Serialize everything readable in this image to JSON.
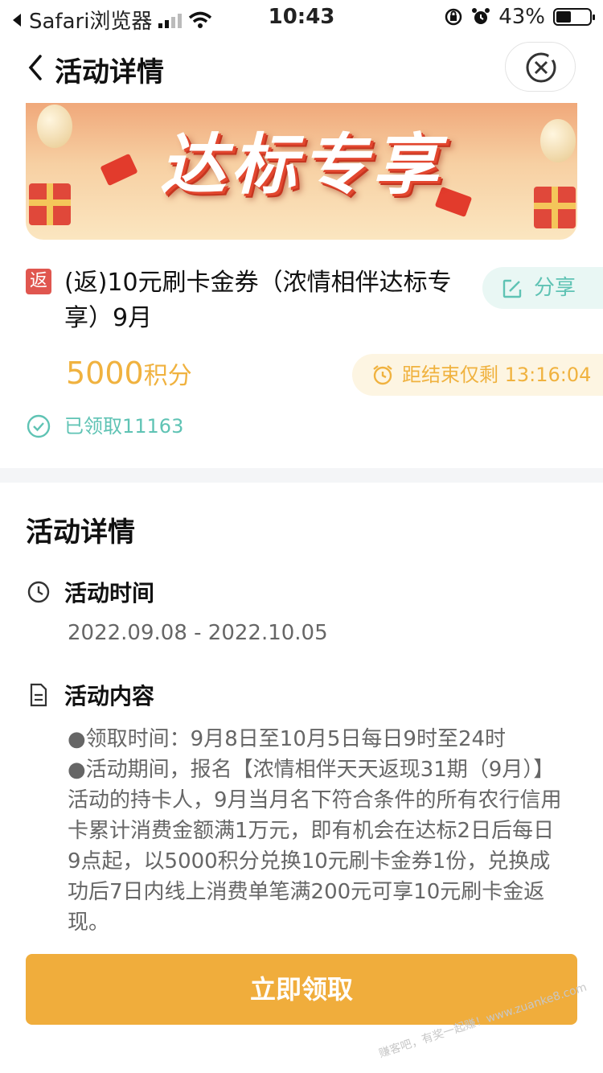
{
  "status_bar": {
    "back_app": "Safari浏览器",
    "time": "10:43",
    "battery": "43%"
  },
  "nav": {
    "title": "活动详情"
  },
  "banner": {
    "text": "达标专享"
  },
  "product": {
    "tag": "返",
    "title": "(返)10元刷卡金券（浓情相伴达标专享）9月",
    "share_label": "分享",
    "points_value": "5000",
    "points_unit": "积分",
    "countdown": "距结束仅剩 13:16:04",
    "claimed": "已领取11163"
  },
  "details": {
    "section_title": "活动详情",
    "time_label": "活动时间",
    "time_range": "2022.09.08 - 2022.10.05",
    "content_label": "活动内容",
    "content_lines": [
      "●领取时间：9月8日至10月5日每日9时至24时",
      "●活动期间，报名【浓情相伴天天返现31期（9月）】活动的持卡人，9月当月名下符合条件的所有农行信用卡累计消费金额满1万元，即有机会在达标2日后每日9点起，以5000积分兑换10元刷卡金券1份，兑换成功后7日内线上消费单笔满200元可享10元刷卡金返现。"
    ]
  },
  "cta": {
    "label": "立即领取"
  },
  "watermark": "赚客吧，有奖一起赚！www.zuanke8.com",
  "colors": {
    "accent_orange": "#f0ad3c",
    "teal": "#5fc3b4",
    "tag_red": "#e0564f"
  }
}
